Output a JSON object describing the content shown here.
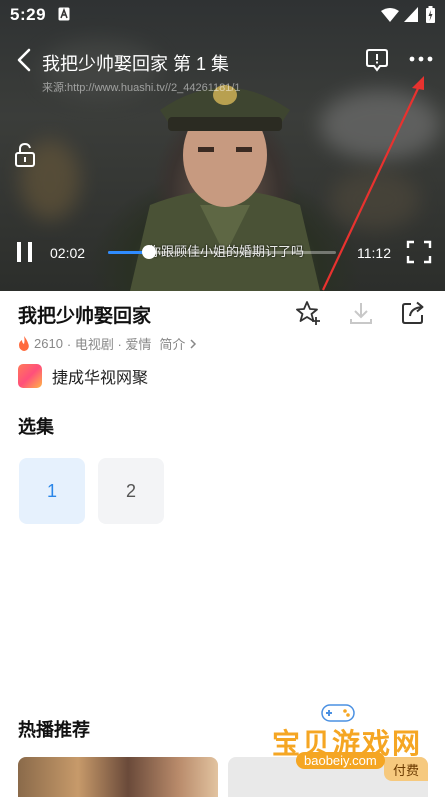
{
  "status_bar": {
    "time": "5:29",
    "notification_icon": "a-box-icon",
    "wifi_icon": "wifi-icon",
    "signal_icon": "signal-icon",
    "battery_icon": "battery-charging-icon"
  },
  "video": {
    "title": "我把少帅娶回家  第 1 集",
    "source_watermark": "来源:http://www.huashi.tv//2_44261181/1",
    "subtitle": "你跟顾佳小姐的婚期订了吗",
    "current_time": "02:02",
    "duration": "11:12",
    "progress_fraction": 0.18,
    "icons": {
      "back": "back-arrow-icon",
      "report": "report-icon",
      "more": "more-icon",
      "lock": "lock-icon",
      "pause": "pause-icon",
      "fullscreen": "fullscreen-icon"
    }
  },
  "info": {
    "title": "我把少帅娶回家",
    "heat": "2610",
    "meta": "· 电视剧 · 爱情",
    "intro_link": "简介",
    "actions": {
      "favorite": "star-plus-icon",
      "download": "download-icon",
      "share": "share-icon"
    },
    "provider": "捷成华视网聚"
  },
  "episodes": {
    "heading": "选集",
    "items": [
      "1",
      "2"
    ],
    "selected": "1"
  },
  "recommend": {
    "heading": "热播推荐",
    "paid_badge": "付费"
  },
  "watermark": {
    "name": "宝贝游戏网",
    "url": "baobeiy.com"
  },
  "colors": {
    "accent": "#2f8cff",
    "selected_episode_bg": "#e6f1fd",
    "heat_icon": "#ff6a3d",
    "arrow": "#e8322f"
  }
}
